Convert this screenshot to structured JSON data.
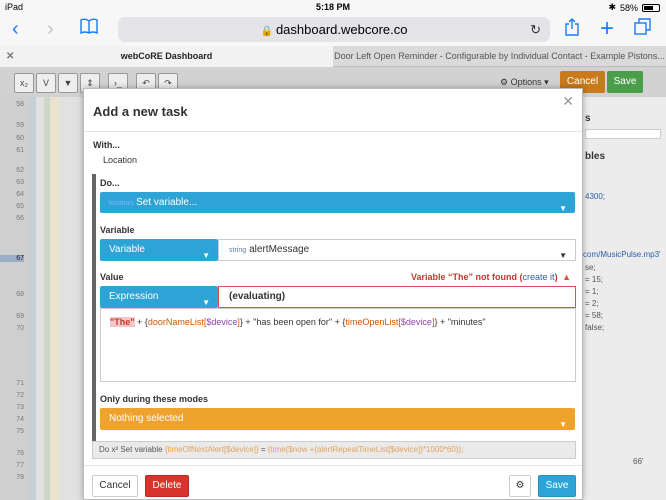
{
  "status": {
    "carrier": "iPad",
    "time": "5:18 PM",
    "battery": "58%"
  },
  "browser": {
    "url": "dashboard.webcore.co",
    "tabs": [
      {
        "label": "webCoRE Dashboard"
      },
      {
        "label": "Door Left Open Reminder - Configurable by Individual Contact - Example Pistons..."
      }
    ]
  },
  "bg": {
    "options": "Options",
    "cancel": "Cancel",
    "save": "Save",
    "line_numbers": [
      "58",
      "59",
      "60",
      "61",
      "62",
      "63",
      "64",
      "65",
      "66",
      "67",
      "68",
      "69",
      "70",
      "71",
      "72",
      "73",
      "74",
      "75",
      "76",
      "77",
      "78"
    ],
    "right_title_fragment": "s",
    "right_section": "bles",
    "right_lines": [
      "4300;",
      "com/MusicPulse.mp3'",
      "se;",
      "= 15;",
      "= 1;",
      "= 2;",
      "= 58;",
      "false;",
      "66'"
    ]
  },
  "modal": {
    "title": "Add a new task",
    "with_label": "With...",
    "with_value": "Location",
    "do_label": "Do...",
    "do_tag": "location",
    "do_value": "Set variable...",
    "variable_label": "Variable",
    "variable_type": "Variable",
    "variable_tag": "string",
    "variable_value": "alertMessage",
    "value_label": "Value",
    "value_error": "Variable “The” not found (",
    "value_error_link": "create it",
    "value_error_end": ")",
    "expression_type": "Expression",
    "expression_value": "(evaluating)",
    "code": {
      "p1": "\"The\"",
      "p2": " + {",
      "p3": "doorNameList[",
      "p4": "$device",
      "p5": "]",
      "p6": "} + \"has been open for\" + {",
      "p7": "timeOpenList[",
      "p8": "$device",
      "p9": "]",
      "p10": "} + \"minutes\""
    },
    "modes_label": "Only during these modes",
    "modes_value": "Nothing selected",
    "summary_prefix": "Do x² Set variable ",
    "summary_var": "{timeOfNextAlert[$device]}",
    "summary_eq": " = ",
    "summary_expr": "{time($now +(alertRepeatTimeList[$device])*1000*60)};",
    "cancel": "Cancel",
    "delete": "Delete",
    "save": "Save"
  }
}
